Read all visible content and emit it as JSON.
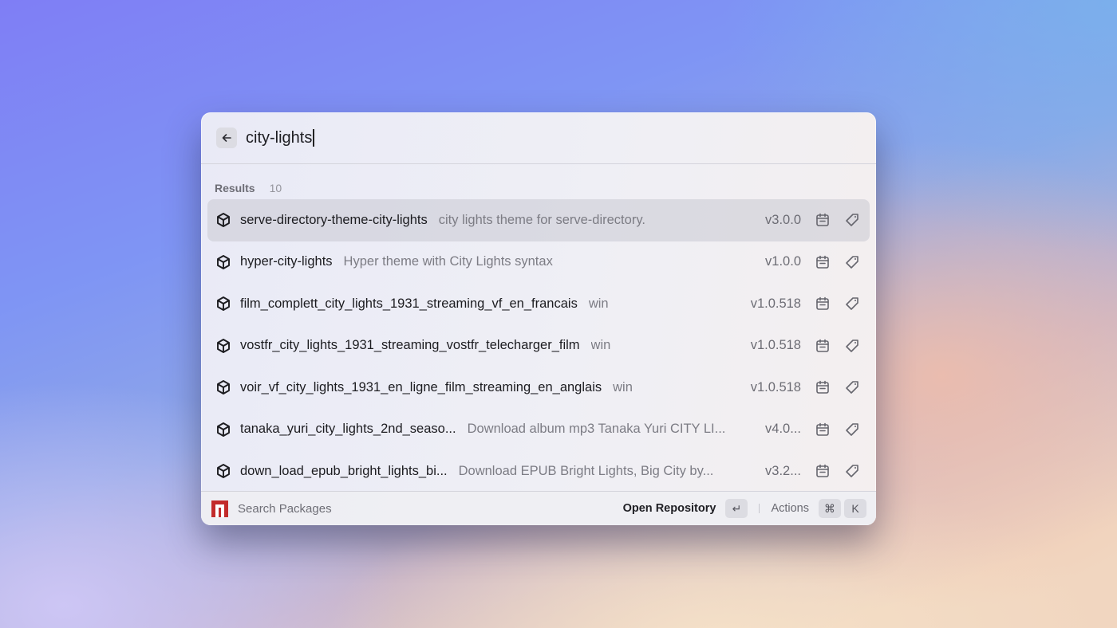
{
  "search": {
    "query": "city-lights",
    "back_icon": "arrow-left-icon"
  },
  "results": {
    "title": "Results",
    "count": "10",
    "items": [
      {
        "name": "serve-directory-theme-city-lights",
        "description": "city lights theme for serve-directory.",
        "version": "v3.0.0",
        "selected": true
      },
      {
        "name": "hyper-city-lights",
        "description": "Hyper theme with City Lights syntax",
        "version": "v1.0.0",
        "selected": false
      },
      {
        "name": "film_complett_city_lights_1931_streaming_vf_en_francais",
        "description": "win",
        "version": "v1.0.518",
        "selected": false
      },
      {
        "name": "vostfr_city_lights_1931_streaming_vostfr_telecharger_film",
        "description": "win",
        "version": "v1.0.518",
        "selected": false
      },
      {
        "name": "voir_vf_city_lights_1931_en_ligne_film_streaming_en_anglais",
        "description": "win",
        "version": "v1.0.518",
        "selected": false
      },
      {
        "name": "tanaka_yuri_city_lights_2nd_seaso...",
        "description": "Download album mp3 Tanaka Yuri CITY LI...",
        "version": "v4.0...",
        "selected": false
      },
      {
        "name": "down_load_epub_bright_lights_bi...",
        "description": "Download EPUB Bright Lights, Big City by...",
        "version": "v3.2...",
        "selected": false
      }
    ],
    "item_icons": {
      "package": "package-cube-icon",
      "date": "calendar-icon",
      "tags": "tag-icon"
    }
  },
  "footer": {
    "logo": "npm-logo-icon",
    "title": "Search Packages",
    "primary_action": "Open Repository",
    "primary_shortcut": "↵",
    "actions_label": "Actions",
    "actions_shortcut": [
      "⌘",
      "K"
    ]
  },
  "colors": {
    "npm_red": "#c22b2b",
    "selected_row": "#cfcfd8"
  }
}
